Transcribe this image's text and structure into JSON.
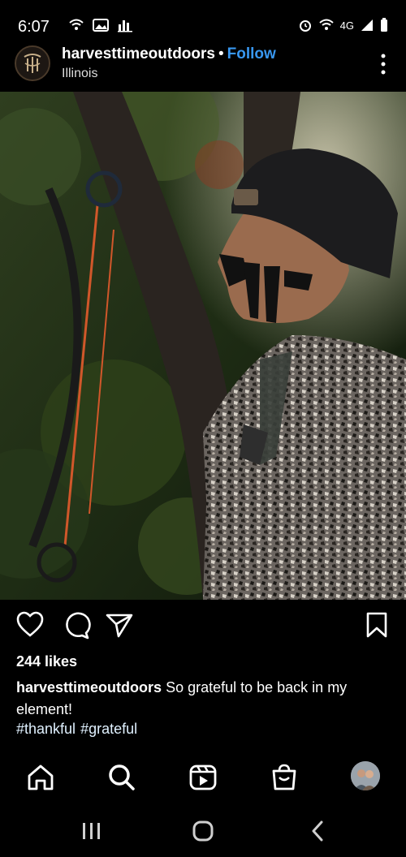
{
  "status_bar": {
    "time": "6:07",
    "network": "4G"
  },
  "post": {
    "username": "harvesttimeoutdoors",
    "separator": "•",
    "follow_label": "Follow",
    "location": "Illinois",
    "likes": "244 likes",
    "caption_user": "harvesttimeoutdoors",
    "caption_text": "So grateful to be back in my element!",
    "hashtags": [
      "#thankful",
      "#grateful"
    ]
  },
  "icons": {
    "like": "heart-icon",
    "comment": "comment-icon",
    "share": "send-icon",
    "save": "bookmark-icon"
  },
  "bottom_nav": [
    "home-icon",
    "search-icon",
    "reels-icon",
    "shop-icon",
    "profile-avatar"
  ],
  "colors": {
    "accent": "#3897f0",
    "background": "#000000"
  }
}
